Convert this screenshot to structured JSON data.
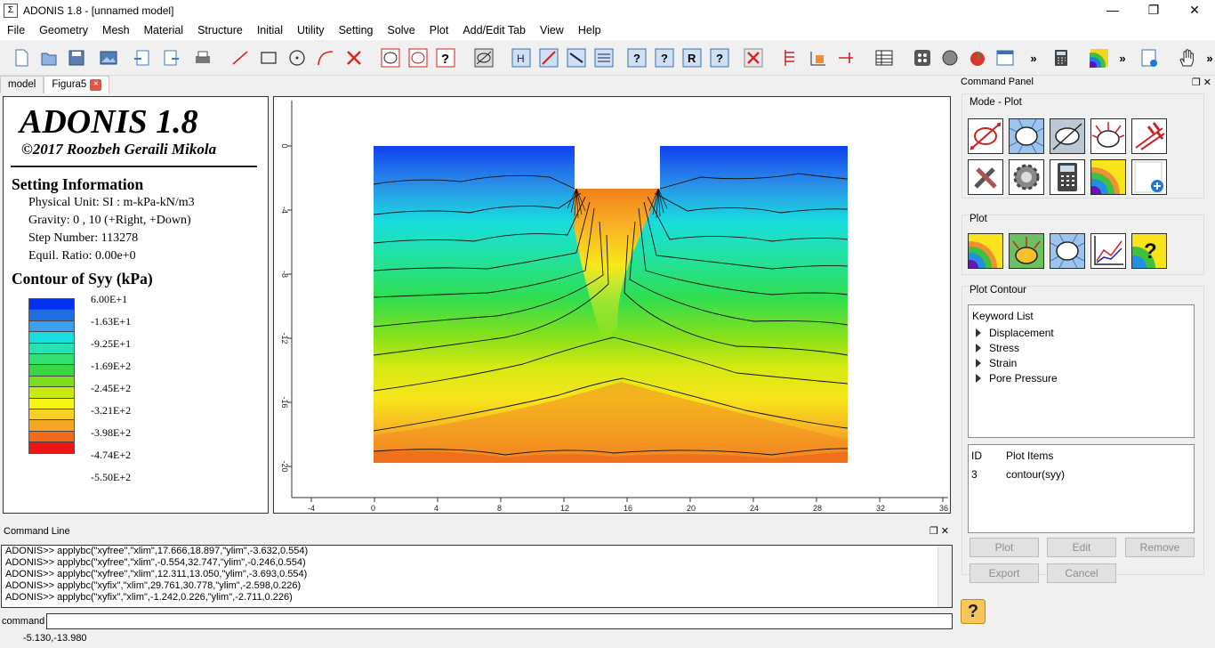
{
  "window": {
    "title": "ADONIS 1.8 - [unnamed model]"
  },
  "menu": [
    "File",
    "Geometry",
    "Mesh",
    "Material",
    "Structure",
    "Initial",
    "Utility",
    "Setting",
    "Solve",
    "Plot",
    "Add/Edit Tab",
    "View",
    "Help"
  ],
  "tabs": {
    "model": "model",
    "figure": "Figura5"
  },
  "info": {
    "brand": "ADONIS 1.8",
    "copyright": "©2017 Roozbeh Geraili Mikola",
    "setting_title": "Setting Information",
    "unit": "Physical Unit: SI : m-kPa-kN/m3",
    "gravity": "Gravity: 0 , 10 (+Right, +Down)",
    "step": "Step Number: 113278",
    "ratio": "Equil. Ratio: 0.00e+0",
    "contour_title": "Contour of Syy (kPa)"
  },
  "legend": {
    "labels": [
      "6.00E+1",
      "-1.63E+1",
      "-9.25E+1",
      "-1.69E+2",
      "-2.45E+2",
      "-3.21E+2",
      "-3.98E+2",
      "-4.74E+2",
      "-5.50E+2"
    ],
    "colors": [
      "#0030f0",
      "#1f6de0",
      "#3c9ef0",
      "#18dede",
      "#26e2b2",
      "#30e070",
      "#38d640",
      "#7ae01e",
      "#c8ea10",
      "#f5f51a",
      "#f8d028",
      "#f6a625",
      "#f26a1a",
      "#ee1515"
    ]
  },
  "plot": {
    "x_ticks": [
      "-4",
      "0",
      "4",
      "8",
      "12",
      "16",
      "20",
      "24",
      "28",
      "32",
      "36"
    ],
    "y_ticks": [
      "0",
      "-4",
      "-8",
      "-12",
      "-16",
      "-20"
    ]
  },
  "cmd_panel": {
    "title": "Command Panel",
    "mode_title": "Mode - Plot",
    "plot_title": "Plot",
    "contour_title": "Plot Contour",
    "keyword_header": "Keyword List",
    "keywords": [
      "Displacement",
      "Stress",
      "Strain",
      "Pore Pressure"
    ],
    "items_header_id": "ID",
    "items_header_name": "Plot Items",
    "items": [
      {
        "id": "3",
        "name": "contour(syy)"
      }
    ],
    "buttons": {
      "plot": "Plot",
      "edit": "Edit",
      "remove": "Remove",
      "export": "Export",
      "cancel": "Cancel"
    }
  },
  "command_line": {
    "title": "Command Line",
    "log": [
      "ADONIS>> applybc(\"xyfree\",\"xlim\",17.666,18.897,\"ylim\",-3.632,0.554)",
      "ADONIS>> applybc(\"xyfree\",\"xlim\",-0.554,32.747,\"ylim\",-0.246,0.554)",
      "ADONIS>> applybc(\"xyfree\",\"xlim\",12.311,13.050,\"ylim\",-3.693,0.554)",
      "ADONIS>> applybc(\"xyfix\",\"xlim\",29.761,30.778,\"ylim\",-2.598,0.226)",
      "ADONIS>> applybc(\"xyfix\",\"xlim\",-1.242,0.226,\"ylim\",-2.711,0.226)"
    ],
    "input_label": "command"
  },
  "status": {
    "coords": "-5.130,-13.980"
  }
}
